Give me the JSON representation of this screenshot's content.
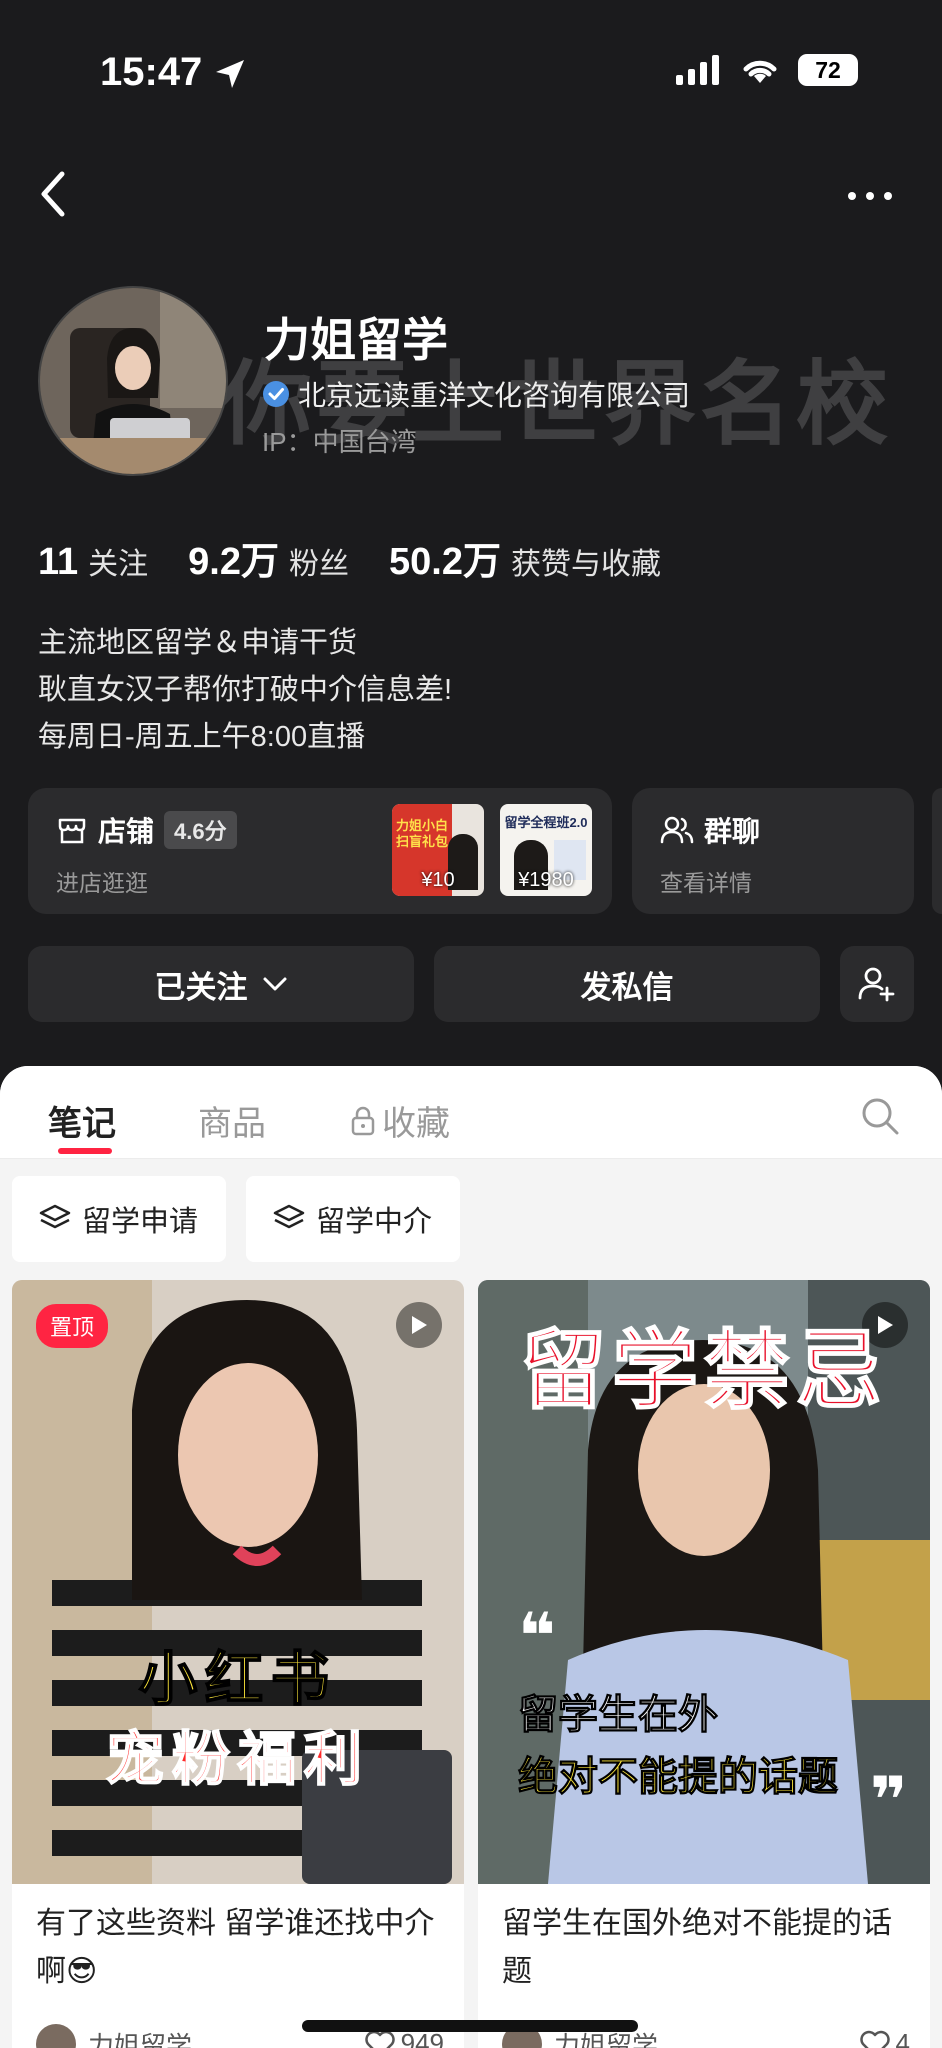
{
  "status_bar": {
    "time": "15:47",
    "battery": "72"
  },
  "profile": {
    "name": "力姐留学",
    "company": "北京远读重洋文化咨询有限公司",
    "ip": "IP：中国台湾",
    "watermark": "你要上世界名校",
    "stats": [
      {
        "value": "11",
        "label": "关注"
      },
      {
        "value": "9.2万",
        "label": "粉丝"
      },
      {
        "value": "50.2万",
        "label": "获赞与收藏"
      }
    ],
    "bio": [
      "主流地区留学＆申请干货",
      "耿直女汉子帮你打破中介信息差!",
      "每周日-周五上午8:00直播"
    ]
  },
  "shop": {
    "title": "店铺",
    "rating": "4.6分",
    "subtitle": "进店逛逛",
    "products": [
      {
        "caption": "力姐小白 扫盲礼包",
        "price": "¥10"
      },
      {
        "caption": "留学全程班2.0",
        "price": "¥1980"
      }
    ]
  },
  "group": {
    "title": "群聊",
    "subtitle": "查看详情"
  },
  "actions": {
    "follow": "已关注",
    "message": "发私信"
  },
  "tabs": [
    {
      "label": "笔记"
    },
    {
      "label": "商品"
    },
    {
      "label": "收藏"
    }
  ],
  "chips": [
    "留学申请",
    "留学中介"
  ],
  "notes": [
    {
      "pin": "置顶",
      "caption_1": "小红书",
      "caption_2": "宠粉福利",
      "title": "有了这些资料 留学谁还找中介啊😎",
      "author": "力姐留学",
      "likes": "949"
    },
    {
      "headline": "留学禁忌",
      "quote_1": "留学生在外",
      "quote_2": "绝对不能提的话题",
      "title": "留学生在国外绝对不能提的话题",
      "author": "力姐留学",
      "likes": "4"
    }
  ],
  "colors": {
    "accent": "#ff2442",
    "verify": "#4a90e2",
    "dark_bg": "#1b1b1d",
    "card_bg": "#2b2b2d"
  }
}
